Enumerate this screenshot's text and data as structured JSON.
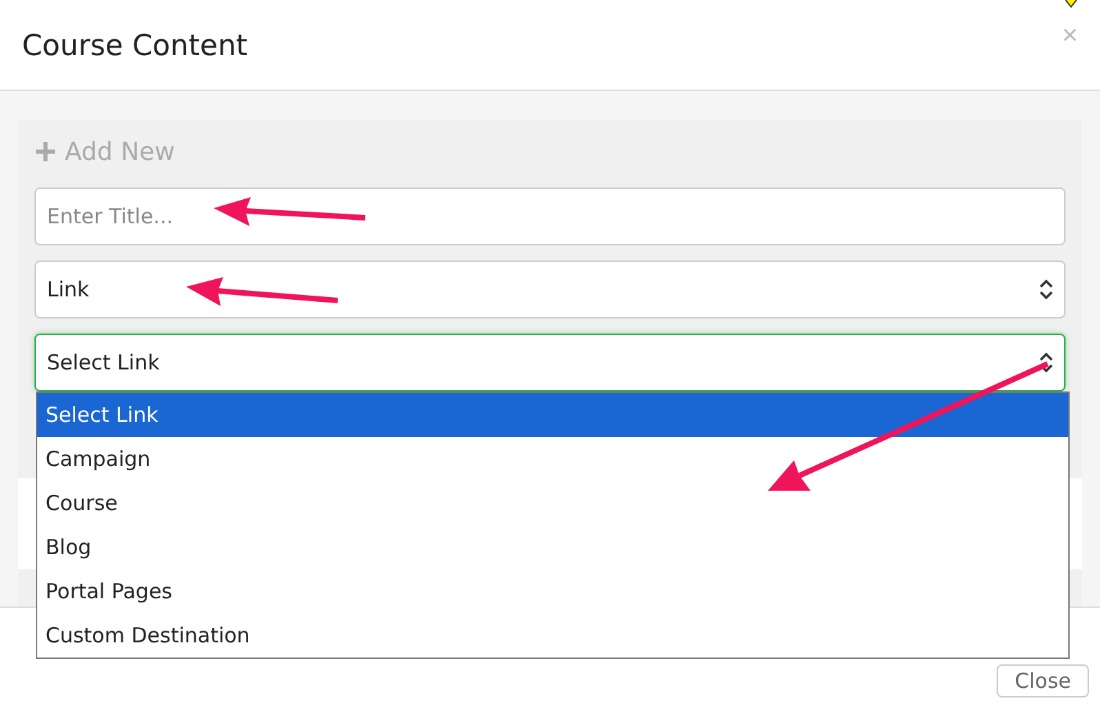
{
  "dialog": {
    "title": "Course Content",
    "close_label": "×"
  },
  "add_new": {
    "label": "Add New"
  },
  "title_field": {
    "placeholder": "Enter Title..."
  },
  "type_select": {
    "value": "Link"
  },
  "link_select": {
    "value": "Select Link",
    "focused": true,
    "options": [
      {
        "label": "Select Link",
        "selected": true
      },
      {
        "label": "Campaign",
        "selected": false
      },
      {
        "label": "Course",
        "selected": false
      },
      {
        "label": "Blog",
        "selected": false
      },
      {
        "label": "Portal Pages",
        "selected": false
      },
      {
        "label": "Custom Destination",
        "selected": false
      }
    ]
  },
  "footer": {
    "buttons": [
      "Close"
    ]
  }
}
